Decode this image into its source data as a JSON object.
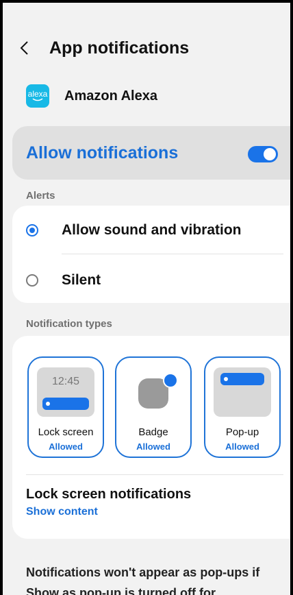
{
  "header": {
    "back_icon": "chevron-left-icon",
    "title": "App notifications"
  },
  "app": {
    "logo_text": "alexa",
    "name": "Amazon Alexa"
  },
  "allow": {
    "label": "Allow notifications",
    "enabled": true,
    "accent": "#1a73e8"
  },
  "alerts": {
    "section_label": "Alerts",
    "options": [
      {
        "label": "Allow sound and vibration",
        "selected": true
      },
      {
        "label": "Silent",
        "selected": false
      }
    ]
  },
  "notification_types": {
    "section_label": "Notification types",
    "lock_screen": {
      "time": "12:45",
      "name": "Lock screen",
      "status": "Allowed"
    },
    "badge": {
      "name": "Badge",
      "status": "Allowed"
    },
    "popup": {
      "name": "Pop-up",
      "status": "Allowed"
    },
    "lock_screen_notifications": {
      "title": "Lock screen notifications",
      "value": "Show content"
    }
  },
  "footer": {
    "text": "Notifications won't appear as pop-ups if Show as pop-up is turned off for"
  }
}
